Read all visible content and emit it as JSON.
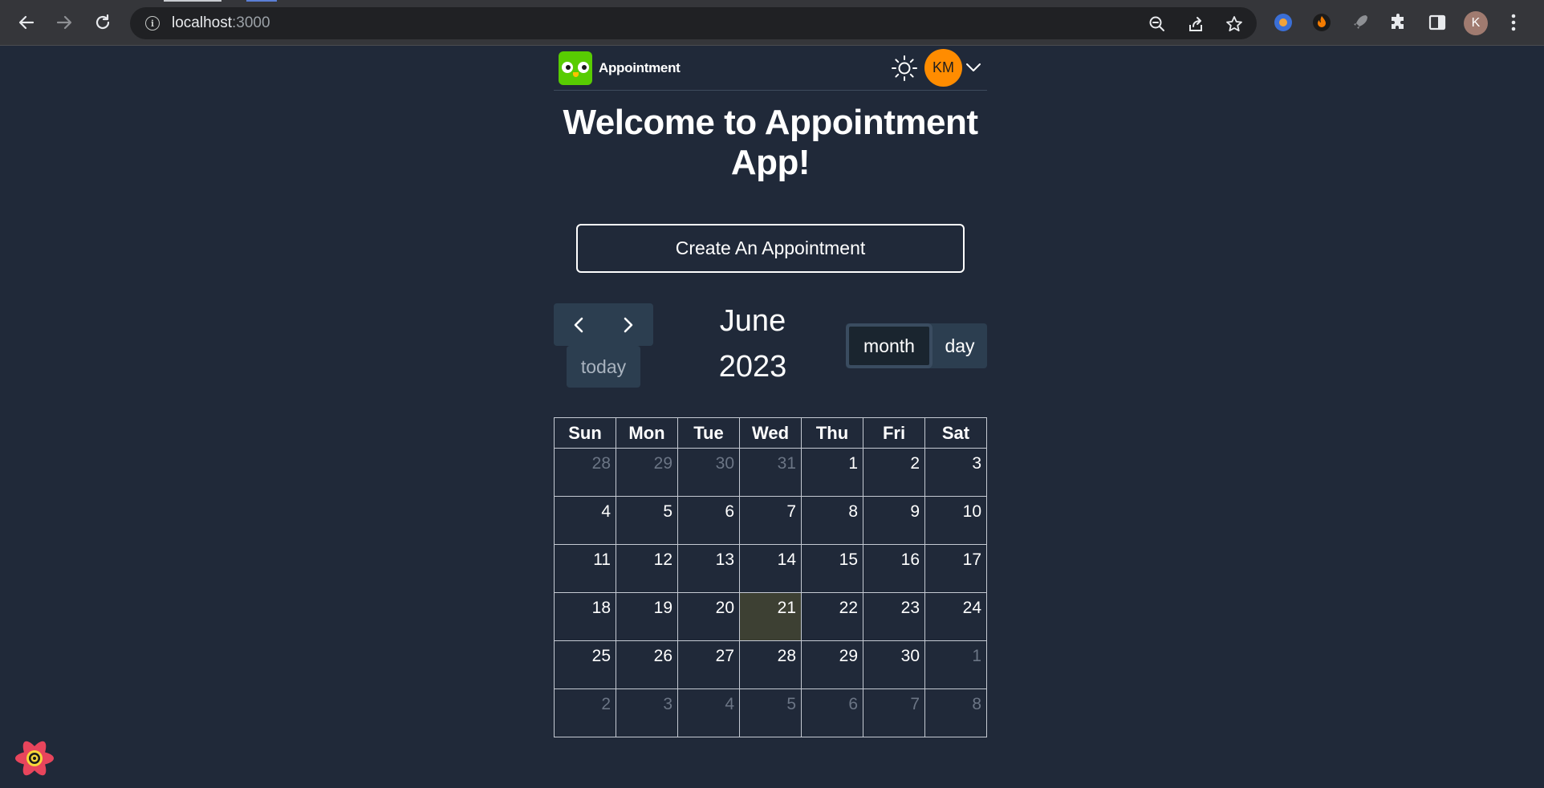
{
  "browser": {
    "url_host": "localhost",
    "url_port": ":3000",
    "profile_initial": "K",
    "icons": {
      "back": "back-arrow-icon",
      "forward": "forward-arrow-icon",
      "reload": "reload-icon",
      "site_info": "info-icon",
      "zoom": "zoom-out-icon",
      "share": "share-icon",
      "bookmark": "star-icon",
      "extensions": "puzzle-icon",
      "side_panel": "side-panel-icon",
      "menu": "kebab-menu-icon"
    }
  },
  "header": {
    "brand": "Appointment",
    "user_initials": "KM",
    "colors": {
      "avatar": "#ff8c00",
      "logo": "#58cc02"
    }
  },
  "main": {
    "title": "Welcome to Appointment App!",
    "create_button": "Create An Appointment"
  },
  "calendar": {
    "today_label": "today",
    "month": "June",
    "year": "2023",
    "views": {
      "month": "month",
      "day": "day"
    },
    "active_view": "month",
    "weekdays": [
      "Sun",
      "Mon",
      "Tue",
      "Wed",
      "Thu",
      "Fri",
      "Sat"
    ],
    "weeks": [
      [
        {
          "d": "28",
          "other": true
        },
        {
          "d": "29",
          "other": true
        },
        {
          "d": "30",
          "other": true
        },
        {
          "d": "31",
          "other": true
        },
        {
          "d": "1"
        },
        {
          "d": "2"
        },
        {
          "d": "3"
        }
      ],
      [
        {
          "d": "4"
        },
        {
          "d": "5"
        },
        {
          "d": "6"
        },
        {
          "d": "7"
        },
        {
          "d": "8"
        },
        {
          "d": "9"
        },
        {
          "d": "10"
        }
      ],
      [
        {
          "d": "11"
        },
        {
          "d": "12"
        },
        {
          "d": "13"
        },
        {
          "d": "14"
        },
        {
          "d": "15"
        },
        {
          "d": "16"
        },
        {
          "d": "17"
        }
      ],
      [
        {
          "d": "18"
        },
        {
          "d": "19"
        },
        {
          "d": "20"
        },
        {
          "d": "21",
          "today": true
        },
        {
          "d": "22"
        },
        {
          "d": "23"
        },
        {
          "d": "24"
        }
      ],
      [
        {
          "d": "25"
        },
        {
          "d": "26"
        },
        {
          "d": "27"
        },
        {
          "d": "28"
        },
        {
          "d": "29"
        },
        {
          "d": "30"
        },
        {
          "d": "1",
          "other": true
        }
      ],
      [
        {
          "d": "2",
          "other": true
        },
        {
          "d": "3",
          "other": true
        },
        {
          "d": "4",
          "other": true
        },
        {
          "d": "5",
          "other": true
        },
        {
          "d": "6",
          "other": true
        },
        {
          "d": "7",
          "other": true
        },
        {
          "d": "8",
          "other": true
        }
      ]
    ],
    "colors": {
      "today_highlight": "#3d4033",
      "button_bg": "#2c3e50"
    }
  }
}
